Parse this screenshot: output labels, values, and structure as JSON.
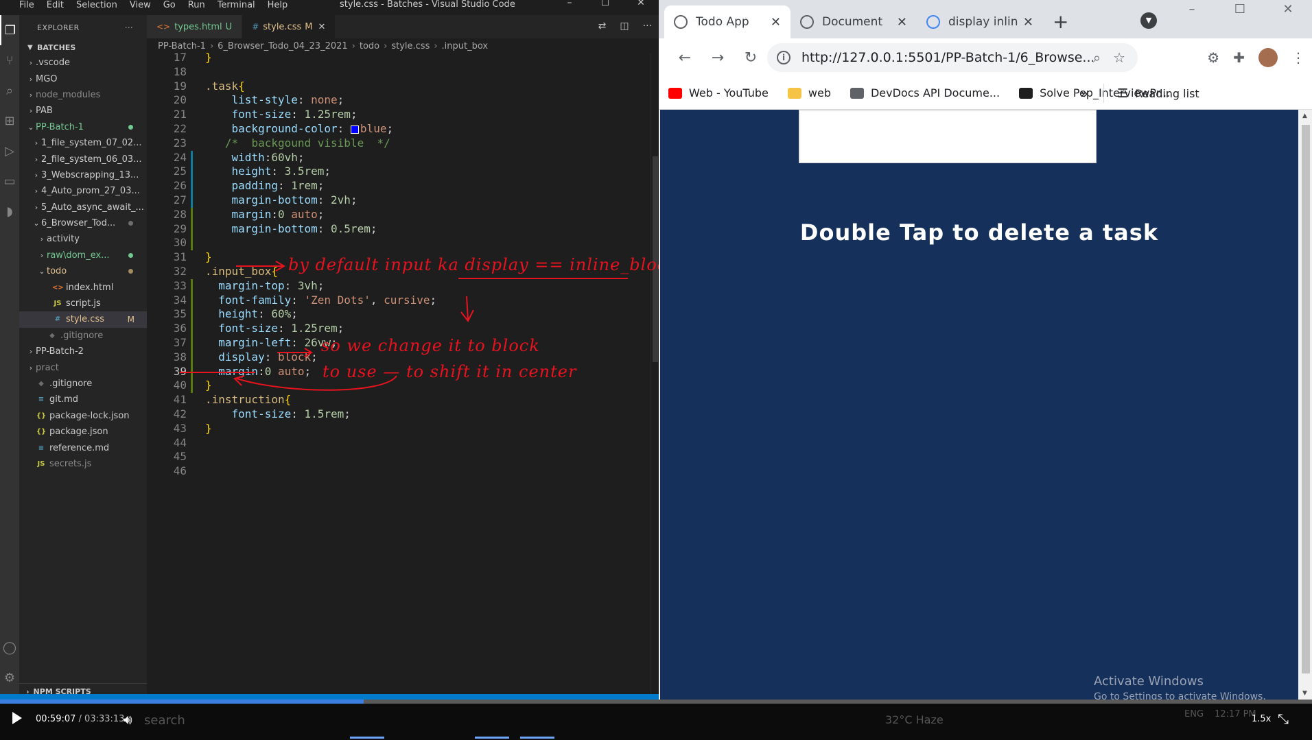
{
  "vscode": {
    "menu": [
      "File",
      "Edit",
      "Selection",
      "View",
      "Go",
      "Run",
      "Terminal",
      "Help"
    ],
    "window_title": "style.css - Batches - Visual Studio Code",
    "explorer_label": "EXPLORER",
    "explorer_more": "···",
    "section": "BATCHES",
    "tree": [
      {
        "label": ".vscode",
        "type": "folder",
        "indent": 1,
        "open": false
      },
      {
        "label": "MGO",
        "type": "folder",
        "indent": 1,
        "open": false
      },
      {
        "label": "node_modules",
        "type": "folder",
        "indent": 1,
        "open": false,
        "dim": true
      },
      {
        "label": "PAB",
        "type": "folder",
        "indent": 1,
        "open": false
      },
      {
        "label": "PP-Batch-1",
        "type": "folder",
        "indent": 1,
        "open": true,
        "status": "green",
        "dot": true
      },
      {
        "label": "1_file_system_07_02...",
        "type": "folder",
        "indent": 2,
        "open": false
      },
      {
        "label": "2_file_system_06_03...",
        "type": "folder",
        "indent": 2,
        "open": false
      },
      {
        "label": "3_Webscrapping_13...",
        "type": "folder",
        "indent": 2,
        "open": false
      },
      {
        "label": "4_Auto_prom_27_03...",
        "type": "folder",
        "indent": 2,
        "open": false
      },
      {
        "label": "5_Auto_async_await_...",
        "type": "folder",
        "indent": 2,
        "open": false
      },
      {
        "label": "6_Browser_Tod...",
        "type": "folder",
        "indent": 2,
        "open": true,
        "dot": true
      },
      {
        "label": "activity",
        "type": "folder",
        "indent": 3,
        "open": false
      },
      {
        "label": "raw\\dom_ex...",
        "type": "folder",
        "indent": 3,
        "open": false,
        "status": "green",
        "dot": true
      },
      {
        "label": "todo",
        "type": "folder",
        "indent": 3,
        "open": true,
        "status": "mod",
        "dot": true
      },
      {
        "label": "index.html",
        "type": "html",
        "indent": 4
      },
      {
        "label": "script.js",
        "type": "js",
        "indent": 4
      },
      {
        "label": "style.css",
        "type": "css",
        "indent": 4,
        "status": "mod",
        "mod": "M",
        "selected": true
      },
      {
        "label": ".gitignore",
        "type": "git",
        "indent": 3,
        "status": "ign"
      },
      {
        "label": "PP-Batch-2",
        "type": "folder",
        "indent": 1,
        "open": false
      },
      {
        "label": "pract",
        "type": "folder",
        "indent": 1,
        "open": false,
        "dim": true
      },
      {
        "label": ".gitignore",
        "type": "git",
        "indent": 1
      },
      {
        "label": "git.md",
        "type": "md",
        "indent": 1
      },
      {
        "label": "package-lock.json",
        "type": "json",
        "indent": 1
      },
      {
        "label": "package.json",
        "type": "json",
        "indent": 1
      },
      {
        "label": "reference.md",
        "type": "md",
        "indent": 1
      },
      {
        "label": "secrets.js",
        "type": "js",
        "indent": 1,
        "dim": true
      }
    ],
    "npm_scripts": "NPM SCRIPTS",
    "tabs": [
      {
        "label": "types.html",
        "flag": "U",
        "icon": "<>",
        "active": false
      },
      {
        "label": "style.css",
        "flag": "M",
        "icon": "#",
        "active": true
      }
    ],
    "breadcrumb": [
      "PP-Batch-1",
      "6_Browser_Todo_04_23_2021",
      "todo",
      "style.css",
      ".input_box"
    ],
    "gutter_start": 17,
    "current_line": 39,
    "code_lines": [
      [
        [
          "brk",
          "}"
        ]
      ],
      [],
      [
        [
          "sel-tag",
          ".task"
        ],
        [
          "brk",
          "{"
        ]
      ],
      [
        [
          "",
          "    "
        ],
        [
          "prop",
          "list-style"
        ],
        [
          "",
          ": "
        ],
        [
          "val",
          "none"
        ],
        [
          "",
          ";"
        ]
      ],
      [
        [
          "",
          "    "
        ],
        [
          "prop",
          "font-size"
        ],
        [
          "",
          ": "
        ],
        [
          "num",
          "1.25rem"
        ],
        [
          "",
          ";"
        ]
      ],
      [
        [
          "",
          "    "
        ],
        [
          "prop",
          "background-color"
        ],
        [
          "",
          ": "
        ],
        [
          "swatch",
          ""
        ],
        [
          "val",
          "blue"
        ],
        [
          "",
          ";"
        ]
      ],
      [
        [
          "",
          "   "
        ],
        [
          "cmt",
          "/*  backgound visible  */"
        ]
      ],
      [
        [
          "",
          "    "
        ],
        [
          "prop",
          "width"
        ],
        [
          "",
          ":"
        ],
        [
          "num",
          "60vh"
        ],
        [
          "",
          ";"
        ]
      ],
      [
        [
          "",
          "    "
        ],
        [
          "prop",
          "height"
        ],
        [
          "",
          ": "
        ],
        [
          "num",
          "3.5rem"
        ],
        [
          "",
          ";"
        ]
      ],
      [
        [
          "",
          "    "
        ],
        [
          "prop",
          "padding"
        ],
        [
          "",
          ": "
        ],
        [
          "num",
          "1rem"
        ],
        [
          "",
          ";"
        ]
      ],
      [
        [
          "",
          "    "
        ],
        [
          "prop",
          "margin-bottom"
        ],
        [
          "",
          ": "
        ],
        [
          "num",
          "2vh"
        ],
        [
          "",
          ";"
        ]
      ],
      [
        [
          "",
          "    "
        ],
        [
          "prop",
          "margin"
        ],
        [
          "",
          ":"
        ],
        [
          "num",
          "0"
        ],
        [
          "val",
          " auto"
        ],
        [
          "",
          ";"
        ]
      ],
      [
        [
          "",
          "    "
        ],
        [
          "prop",
          "margin-bottom"
        ],
        [
          "",
          ": "
        ],
        [
          "num",
          "0.5rem"
        ],
        [
          "",
          ";"
        ]
      ],
      [],
      [
        [
          "brk",
          "}"
        ]
      ],
      [
        [
          "sel-tag",
          ".input_box"
        ],
        [
          "brk",
          "{"
        ]
      ],
      [
        [
          "",
          "  "
        ],
        [
          "prop",
          "margin-top"
        ],
        [
          "",
          ": "
        ],
        [
          "num",
          "3vh"
        ],
        [
          "",
          ";"
        ]
      ],
      [
        [
          "",
          "  "
        ],
        [
          "prop",
          "font-family"
        ],
        [
          "",
          ": "
        ],
        [
          "val",
          "'Zen Dots'"
        ],
        [
          "",
          ", "
        ],
        [
          "val",
          "cursive"
        ],
        [
          "",
          ";"
        ]
      ],
      [
        [
          "",
          "  "
        ],
        [
          "prop",
          "height"
        ],
        [
          "",
          ": "
        ],
        [
          "num",
          "60%"
        ],
        [
          "",
          ";"
        ]
      ],
      [
        [
          "",
          "  "
        ],
        [
          "prop",
          "font-size"
        ],
        [
          "",
          ": "
        ],
        [
          "num",
          "1.25rem"
        ],
        [
          "",
          ";"
        ]
      ],
      [
        [
          "",
          "  "
        ],
        [
          "prop",
          "margin-left"
        ],
        [
          "",
          ": "
        ],
        [
          "num",
          "26vw"
        ],
        [
          "",
          ";"
        ]
      ],
      [
        [
          "",
          "  "
        ],
        [
          "prop",
          "display"
        ],
        [
          "",
          ": "
        ],
        [
          "val",
          "block"
        ],
        [
          "",
          ";"
        ]
      ],
      [
        [
          "",
          "  "
        ],
        [
          "prop",
          "margin"
        ],
        [
          "",
          ":"
        ],
        [
          "num",
          "0"
        ],
        [
          "val",
          " auto"
        ],
        [
          "",
          ";"
        ]
      ],
      [
        [
          "brk",
          "}"
        ]
      ],
      [
        [
          "sel-tag",
          ".instruction"
        ],
        [
          "brk",
          "{"
        ]
      ],
      [
        [
          "",
          "    "
        ],
        [
          "prop",
          "font-size"
        ],
        [
          "",
          ": "
        ],
        [
          "num",
          "1.5rem"
        ],
        [
          "",
          ";"
        ]
      ],
      [
        [
          "brk",
          "}"
        ]
      ],
      [],
      [],
      []
    ],
    "annotations": {
      "line1": "by default  input ka  display == inline_block",
      "line2": "so we change  it to  block",
      "line3": "to use  —  to  shift  it  in  center"
    },
    "colors": {
      "accent": "#007acc",
      "annotation": "#e8131e",
      "activity_bar": "#333333",
      "sidebar": "#252526"
    }
  },
  "browser": {
    "tabs": [
      {
        "label": "Todo App",
        "active": true,
        "icon": "globe-icon"
      },
      {
        "label": "Document",
        "active": false,
        "icon": "globe-icon"
      },
      {
        "label": "display inlin",
        "active": false,
        "icon": "google-icon"
      }
    ],
    "url": "http://127.0.0.1:5501/PP-Batch-1/6_Browse...",
    "bookmarks": [
      {
        "label": "Web - YouTube",
        "icon": "youtube-icon"
      },
      {
        "label": "web",
        "icon": "folder-icon"
      },
      {
        "label": "DevDocs API Docume...",
        "icon": "devdocs-icon"
      },
      {
        "label": "Solve Pep_InterviewPr...",
        "icon": "hackerrank-icon"
      }
    ],
    "bookmarks_more": "»",
    "reading_list": "Reading list",
    "page": {
      "instruction": "Double Tap to delete a task",
      "input_value": "",
      "background": "#15305a"
    },
    "watermark": {
      "title": "Activate Windows",
      "sub": "Go to Settings to activate Windows."
    }
  },
  "player": {
    "time_current": "00:59:07",
    "time_total": "03:33:13",
    "time_sep": " / ",
    "progress": 0.277,
    "speed": "1.5x",
    "taskbar_ghost": {
      "search": "search",
      "weather": "32°C  Haze",
      "lang": "ENG",
      "time": "12:17 PM"
    }
  }
}
